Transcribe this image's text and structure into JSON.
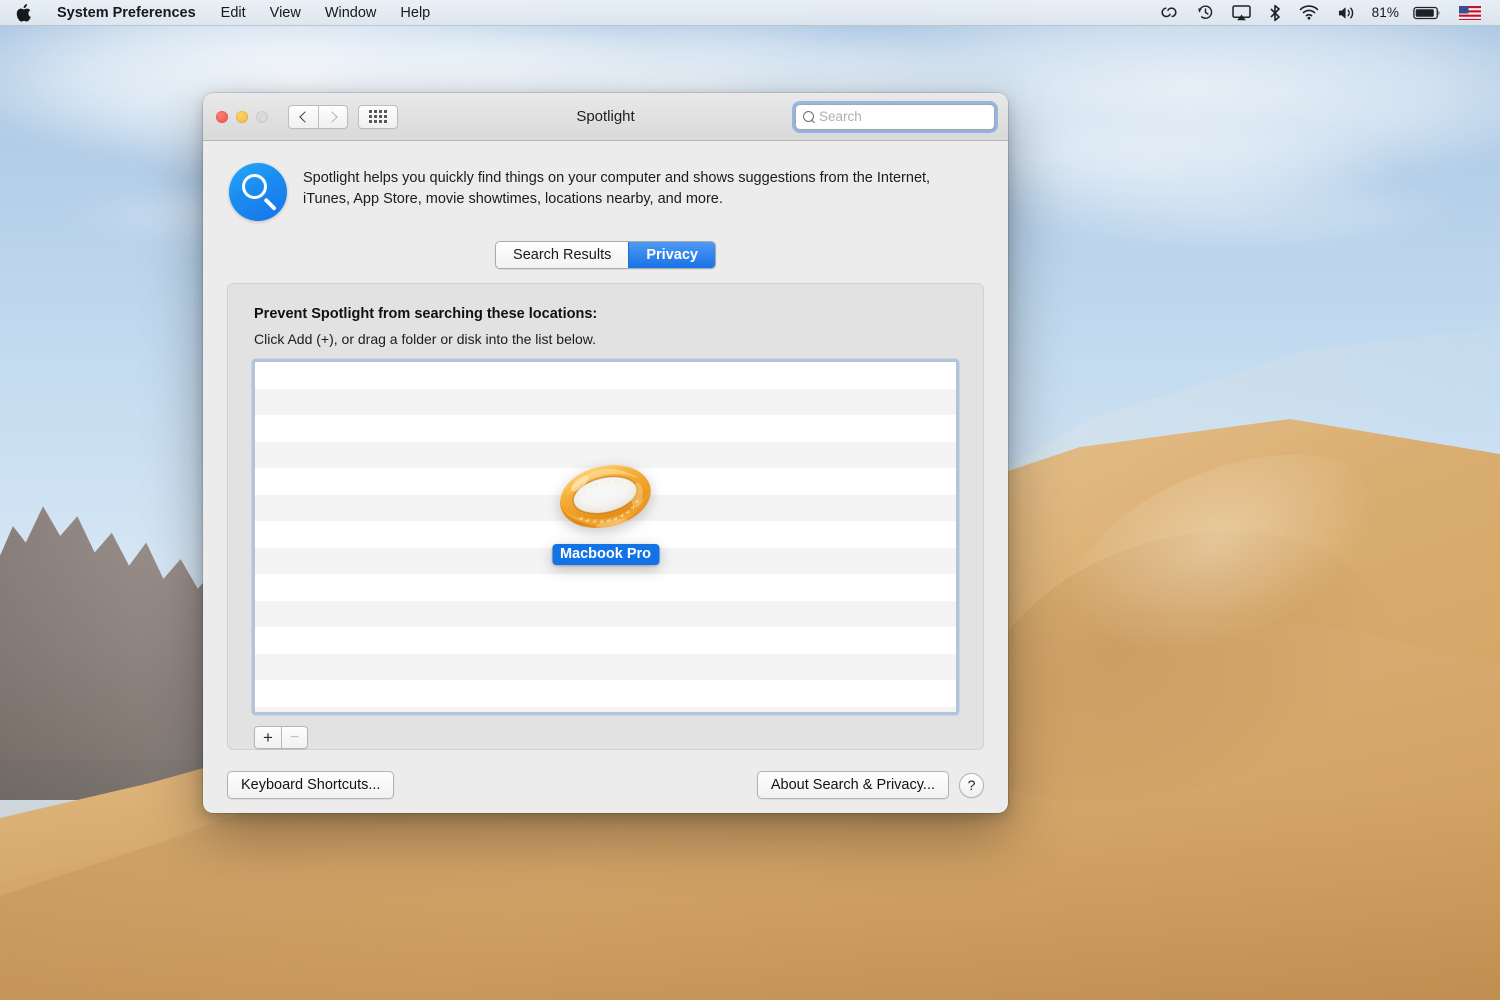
{
  "menubar": {
    "apple_icon": "apple-logo-icon",
    "items": [
      {
        "label": "System Preferences",
        "bold": true
      },
      {
        "label": "Edit",
        "bold": false
      },
      {
        "label": "View",
        "bold": false
      },
      {
        "label": "Window",
        "bold": false
      },
      {
        "label": "Help",
        "bold": false
      }
    ],
    "status_icons": [
      "creative-cloud-icon",
      "time-machine-icon",
      "airplay-icon",
      "bluetooth-icon",
      "wifi-icon",
      "volume-icon"
    ],
    "battery_percent": "81%",
    "battery_icon": "battery-icon",
    "input_flag": "us-flag-icon"
  },
  "window": {
    "title": "Spotlight",
    "traffic_lights": {
      "close": "close-button",
      "minimize": "minimize-button",
      "zoom": "zoom-button-disabled"
    },
    "nav": {
      "back_icon": "chevron-left-icon",
      "forward_icon": "chevron-right-icon",
      "grid_icon": "grid-view-icon"
    },
    "search": {
      "value": "",
      "placeholder": "Search",
      "icon": "search-icon"
    },
    "intro": {
      "icon": "spotlight-icon",
      "text": "Spotlight helps you quickly find things on your computer and shows suggestions from the Internet, iTunes, App Store, movie showtimes, locations nearby, and more."
    },
    "tabs": [
      {
        "label": "Search Results",
        "active": false
      },
      {
        "label": "Privacy",
        "active": true
      }
    ],
    "privacy": {
      "heading": "Prevent Spotlight from searching these locations:",
      "subheading": "Click Add (+), or drag a folder or disk into the list below.",
      "list_items": [],
      "drag_item": {
        "label": "Macbook Pro",
        "icon": "gold-ring-icon",
        "highlight_color": "#1273e6"
      },
      "add_button": "+",
      "remove_button": "−",
      "remove_disabled": true
    },
    "footer": {
      "keyboard_shortcuts": "Keyboard Shortcuts...",
      "about_search_privacy": "About Search & Privacy...",
      "help": "?"
    }
  },
  "colors": {
    "accent_blue": "#1a72e6",
    "window_bg": "#ececec",
    "panel_bg": "#e2e2e2",
    "focus_ring": "#5692e8",
    "sand": "#dcb176",
    "sky": "#b7d1ea"
  }
}
